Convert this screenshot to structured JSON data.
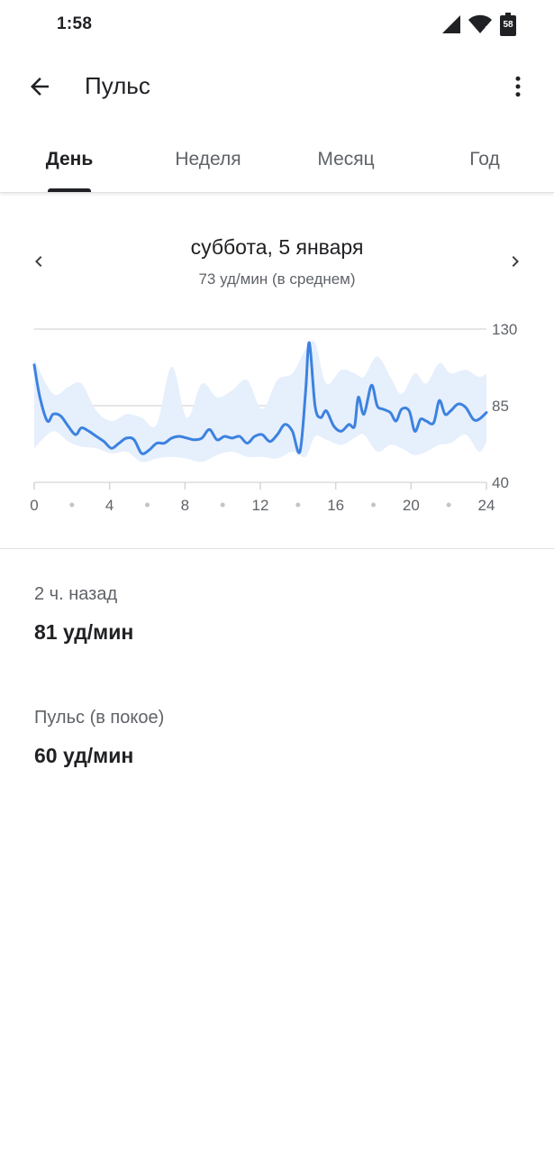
{
  "status_bar": {
    "time": "1:58",
    "battery_level": "58",
    "icons": [
      "signal-icon",
      "wifi-icon",
      "battery-icon"
    ]
  },
  "app_bar": {
    "title": "Пульс",
    "back_icon": "arrow-back-icon",
    "menu_icon": "more-vert-icon"
  },
  "tabs": [
    {
      "label": "День",
      "active": true
    },
    {
      "label": "Неделя",
      "active": false
    },
    {
      "label": "Месяц",
      "active": false
    },
    {
      "label": "Год",
      "active": false
    }
  ],
  "date_header": {
    "title": "суббота, 5 января",
    "subtitle": "73 уд/мин (в среднем)"
  },
  "colors": {
    "line": "#3c82e0",
    "band": "#e6effc",
    "text_primary": "#202124",
    "text_secondary": "#5f6368",
    "grid": "#d5d5d5"
  },
  "chart_data": {
    "type": "line",
    "xlim": [
      0,
      24
    ],
    "ylim": [
      40,
      130
    ],
    "x_ticks": [
      "0",
      "4",
      "8",
      "12",
      "16",
      "20",
      "24"
    ],
    "y_ticks": [
      "130",
      "85",
      "40"
    ],
    "grid": true,
    "series": [
      {
        "x": [
          0,
          0.3,
          0.7,
          1.0,
          1.4,
          1.8,
          2.2,
          2.5,
          2.9,
          3.3,
          3.7,
          4.1,
          4.5,
          4.9,
          5.3,
          5.7,
          6.1,
          6.5,
          6.9,
          7.3,
          7.7,
          8.1,
          8.5,
          8.9,
          9.3,
          9.7,
          10.1,
          10.5,
          10.9,
          11.3,
          11.7,
          12.1,
          12.5,
          12.9,
          13.3,
          13.7,
          14.1,
          14.4,
          14.6,
          14.9,
          15.2,
          15.5,
          15.9,
          16.3,
          16.7,
          17.0,
          17.2,
          17.5,
          17.9,
          18.2,
          18.5,
          18.9,
          19.2,
          19.5,
          19.9,
          20.2,
          20.5,
          20.8,
          21.2,
          21.5,
          21.8,
          22.1,
          22.5,
          22.9,
          23.3,
          23.6,
          24.0
        ],
        "y": [
          109,
          90,
          76,
          80,
          79,
          73,
          68,
          72,
          70,
          67,
          64,
          60,
          63,
          66,
          65,
          57,
          59,
          63,
          63,
          66,
          67,
          66,
          65,
          66,
          71,
          65,
          67,
          66,
          67,
          63,
          67,
          68,
          64,
          68,
          74,
          70,
          58,
          93,
          122,
          85,
          78,
          82,
          73,
          70,
          74,
          73,
          90,
          80,
          97,
          85,
          83,
          81,
          76,
          83,
          82,
          70,
          77,
          76,
          75,
          88,
          80,
          82,
          86,
          84,
          77,
          77,
          81
        ]
      }
    ],
    "band": {
      "x": [
        0,
        1.0,
        1.8,
        2.5,
        3.3,
        4.1,
        4.9,
        5.7,
        6.5,
        7.3,
        8.1,
        8.9,
        9.7,
        10.5,
        11.3,
        12.1,
        12.9,
        13.7,
        14.4,
        14.9,
        15.5,
        16.3,
        17.0,
        17.5,
        18.2,
        18.9,
        19.5,
        20.2,
        20.8,
        21.5,
        22.1,
        22.9,
        23.6,
        24.0
      ],
      "low": [
        60,
        70,
        64,
        61,
        60,
        57,
        58,
        52,
        54,
        55,
        54,
        52,
        56,
        58,
        55,
        55,
        54,
        58,
        55,
        67,
        65,
        62,
        66,
        68,
        58,
        62,
        60,
        56,
        58,
        62,
        63,
        68,
        58,
        64
      ],
      "high": [
        112,
        92,
        96,
        98,
        82,
        76,
        80,
        78,
        74,
        108,
        78,
        98,
        90,
        94,
        100,
        83,
        100,
        104,
        118,
        122,
        98,
        106,
        104,
        102,
        114,
        102,
        92,
        104,
        98,
        110,
        104,
        106,
        102,
        104
      ]
    }
  },
  "info_blocks": [
    {
      "label": "2 ч. назад",
      "value": "81 уд/мин"
    },
    {
      "label": "Пульс (в покое)",
      "value": "60 уд/мин"
    }
  ]
}
